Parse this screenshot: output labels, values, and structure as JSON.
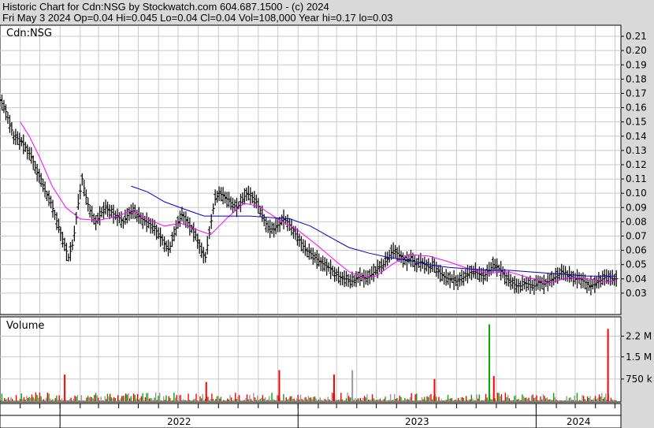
{
  "header": {
    "line1": "Historic Chart for Cdn:NSG by Stockwatch.com 604.687.1500 - (c) 2024",
    "line2": "Fri May  3 2024   Op=0.04   Hi=0.045   Lo=0.04   Cl=0.04   Vol=108,000   Year hi=0.17   lo=0.03"
  },
  "chart_data": [
    {
      "type": "line",
      "subtype": "ohlc",
      "title": "Cdn:NSG",
      "ylim": [
        0.02,
        0.215
      ],
      "y_ticks": [
        "0.21",
        "0.20",
        "0.19",
        "0.18",
        "0.17",
        "0.16",
        "0.15",
        "0.14",
        "0.13",
        "0.12",
        "0.11",
        "0.10",
        "0.09",
        "0.08",
        "0.07",
        "0.06",
        "0.05",
        "0.04",
        "0.03"
      ],
      "y_tick_values": [
        0.21,
        0.2,
        0.19,
        0.18,
        0.17,
        0.16,
        0.15,
        0.14,
        0.13,
        0.12,
        0.11,
        0.1,
        0.09,
        0.08,
        0.07,
        0.06,
        0.05,
        0.04,
        0.03
      ],
      "x_labels": [
        "2022",
        "2023",
        "2024"
      ],
      "x_range": [
        "2021-10",
        "2024-05"
      ],
      "grid": true,
      "price_path": [
        [
          "2021-10-01",
          0.165
        ],
        [
          "2021-10-08",
          0.16
        ],
        [
          "2021-10-15",
          0.15
        ],
        [
          "2021-10-22",
          0.14
        ],
        [
          "2021-10-29",
          0.138
        ],
        [
          "2021-11-05",
          0.135
        ],
        [
          "2021-11-12",
          0.13
        ],
        [
          "2021-11-19",
          0.125
        ],
        [
          "2021-11-26",
          0.115
        ],
        [
          "2021-12-03",
          0.11
        ],
        [
          "2021-12-10",
          0.1
        ],
        [
          "2021-12-17",
          0.095
        ],
        [
          "2021-12-24",
          0.085
        ],
        [
          "2021-12-31",
          0.075
        ],
        [
          "2022-01-07",
          0.065
        ],
        [
          "2022-01-14",
          0.055
        ],
        [
          "2022-01-21",
          0.065
        ],
        [
          "2022-01-28",
          0.09
        ],
        [
          "2022-02-04",
          0.11
        ],
        [
          "2022-02-11",
          0.095
        ],
        [
          "2022-02-18",
          0.085
        ],
        [
          "2022-02-25",
          0.08
        ],
        [
          "2022-03-04",
          0.085
        ],
        [
          "2022-03-11",
          0.09
        ],
        [
          "2022-03-18",
          0.088
        ],
        [
          "2022-03-25",
          0.085
        ],
        [
          "2022-04-01",
          0.083
        ],
        [
          "2022-04-08",
          0.08
        ],
        [
          "2022-04-15",
          0.085
        ],
        [
          "2022-04-22",
          0.088
        ],
        [
          "2022-04-29",
          0.085
        ],
        [
          "2022-05-06",
          0.082
        ],
        [
          "2022-05-13",
          0.08
        ],
        [
          "2022-05-20",
          0.078
        ],
        [
          "2022-05-27",
          0.075
        ],
        [
          "2022-06-03",
          0.07
        ],
        [
          "2022-06-10",
          0.065
        ],
        [
          "2022-06-17",
          0.06
        ],
        [
          "2022-06-24",
          0.07
        ],
        [
          "2022-07-01",
          0.08
        ],
        [
          "2022-07-08",
          0.085
        ],
        [
          "2022-07-15",
          0.08
        ],
        [
          "2022-07-22",
          0.075
        ],
        [
          "2022-07-29",
          0.07
        ],
        [
          "2022-08-05",
          0.06
        ],
        [
          "2022-08-12",
          0.055
        ],
        [
          "2022-08-19",
          0.075
        ],
        [
          "2022-08-26",
          0.095
        ],
        [
          "2022-09-02",
          0.1
        ],
        [
          "2022-09-09",
          0.098
        ],
        [
          "2022-09-16",
          0.095
        ],
        [
          "2022-09-23",
          0.092
        ],
        [
          "2022-09-30",
          0.09
        ],
        [
          "2022-10-07",
          0.095
        ],
        [
          "2022-10-14",
          0.1
        ],
        [
          "2022-10-21",
          0.098
        ],
        [
          "2022-10-28",
          0.095
        ],
        [
          "2022-11-04",
          0.088
        ],
        [
          "2022-11-11",
          0.08
        ],
        [
          "2022-11-18",
          0.075
        ],
        [
          "2022-11-25",
          0.075
        ],
        [
          "2022-12-02",
          0.078
        ],
        [
          "2022-12-09",
          0.082
        ],
        [
          "2022-12-16",
          0.08
        ],
        [
          "2022-12-23",
          0.075
        ],
        [
          "2022-12-30",
          0.07
        ],
        [
          "2023-01-06",
          0.065
        ],
        [
          "2023-01-13",
          0.06
        ],
        [
          "2023-01-20",
          0.058
        ],
        [
          "2023-01-27",
          0.055
        ],
        [
          "2023-02-03",
          0.052
        ],
        [
          "2023-02-10",
          0.05
        ],
        [
          "2023-02-17",
          0.048
        ],
        [
          "2023-02-24",
          0.045
        ],
        [
          "2023-03-03",
          0.042
        ],
        [
          "2023-03-10",
          0.04
        ],
        [
          "2023-03-17",
          0.04
        ],
        [
          "2023-03-24",
          0.038
        ],
        [
          "2023-03-31",
          0.04
        ],
        [
          "2023-04-07",
          0.042
        ],
        [
          "2023-04-14",
          0.04
        ],
        [
          "2023-04-21",
          0.042
        ],
        [
          "2023-04-28",
          0.045
        ],
        [
          "2023-05-05",
          0.048
        ],
        [
          "2023-05-12",
          0.05
        ],
        [
          "2023-05-19",
          0.055
        ],
        [
          "2023-05-26",
          0.06
        ],
        [
          "2023-06-02",
          0.058
        ],
        [
          "2023-06-09",
          0.055
        ],
        [
          "2023-06-16",
          0.052
        ],
        [
          "2023-06-23",
          0.055
        ],
        [
          "2023-06-30",
          0.05
        ],
        [
          "2023-07-07",
          0.052
        ],
        [
          "2023-07-14",
          0.05
        ],
        [
          "2023-07-21",
          0.048
        ],
        [
          "2023-07-28",
          0.05
        ],
        [
          "2023-08-04",
          0.045
        ],
        [
          "2023-08-11",
          0.042
        ],
        [
          "2023-08-18",
          0.04
        ],
        [
          "2023-08-25",
          0.04
        ],
        [
          "2023-09-01",
          0.038
        ],
        [
          "2023-09-08",
          0.04
        ],
        [
          "2023-09-15",
          0.042
        ],
        [
          "2023-09-22",
          0.045
        ],
        [
          "2023-09-29",
          0.045
        ],
        [
          "2023-10-06",
          0.043
        ],
        [
          "2023-10-13",
          0.042
        ],
        [
          "2023-10-20",
          0.045
        ],
        [
          "2023-10-27",
          0.05
        ],
        [
          "2023-11-03",
          0.048
        ],
        [
          "2023-11-10",
          0.045
        ],
        [
          "2023-11-17",
          0.04
        ],
        [
          "2023-11-24",
          0.038
        ],
        [
          "2023-12-01",
          0.035
        ],
        [
          "2023-12-08",
          0.035
        ],
        [
          "2023-12-15",
          0.037
        ],
        [
          "2023-12-22",
          0.036
        ],
        [
          "2023-12-29",
          0.035
        ],
        [
          "2024-01-05",
          0.038
        ],
        [
          "2024-01-12",
          0.036
        ],
        [
          "2024-01-19",
          0.038
        ],
        [
          "2024-01-26",
          0.04
        ],
        [
          "2024-02-02",
          0.042
        ],
        [
          "2024-02-09",
          0.045
        ],
        [
          "2024-02-16",
          0.043
        ],
        [
          "2024-02-23",
          0.042
        ],
        [
          "2024-03-01",
          0.04
        ],
        [
          "2024-03-08",
          0.04
        ],
        [
          "2024-03-15",
          0.038
        ],
        [
          "2024-03-22",
          0.035
        ],
        [
          "2024-03-29",
          0.036
        ],
        [
          "2024-04-05",
          0.038
        ],
        [
          "2024-04-12",
          0.04
        ],
        [
          "2024-04-19",
          0.042
        ],
        [
          "2024-04-26",
          0.04
        ],
        [
          "2024-05-03",
          0.04
        ]
      ],
      "series": [
        {
          "name": "short moving average",
          "color": "#ff00ff",
          "points": [
            [
              "2021-11-01",
              0.15
            ],
            [
              "2021-11-15",
              0.14
            ],
            [
              "2021-12-01",
              0.125
            ],
            [
              "2021-12-20",
              0.105
            ],
            [
              "2022-01-10",
              0.09
            ],
            [
              "2022-02-01",
              0.082
            ],
            [
              "2022-03-01",
              0.081
            ],
            [
              "2022-04-01",
              0.084
            ],
            [
              "2022-04-20",
              0.088
            ],
            [
              "2022-05-15",
              0.082
            ],
            [
              "2022-06-10",
              0.077
            ],
            [
              "2022-07-05",
              0.079
            ],
            [
              "2022-08-01",
              0.074
            ],
            [
              "2022-08-20",
              0.071
            ],
            [
              "2022-09-15",
              0.083
            ],
            [
              "2022-10-10",
              0.093
            ],
            [
              "2022-11-01",
              0.091
            ],
            [
              "2022-12-01",
              0.082
            ],
            [
              "2023-01-01",
              0.074
            ],
            [
              "2023-02-01",
              0.063
            ],
            [
              "2023-03-01",
              0.052
            ],
            [
              "2023-03-20",
              0.045
            ],
            [
              "2023-04-10",
              0.041
            ],
            [
              "2023-05-01",
              0.042
            ],
            [
              "2023-05-25",
              0.05
            ],
            [
              "2023-06-20",
              0.057
            ],
            [
              "2023-07-20",
              0.056
            ],
            [
              "2023-08-20",
              0.052
            ],
            [
              "2023-09-20",
              0.047
            ],
            [
              "2023-10-20",
              0.044
            ],
            [
              "2023-11-20",
              0.045
            ],
            [
              "2023-12-20",
              0.041
            ],
            [
              "2024-01-20",
              0.037
            ],
            [
              "2024-02-20",
              0.041
            ],
            [
              "2024-03-20",
              0.04
            ],
            [
              "2024-04-20",
              0.038
            ],
            [
              "2024-05-03",
              0.039
            ]
          ]
        },
        {
          "name": "long moving average",
          "color": "#0000cc",
          "points": [
            [
              "2022-04-20",
              0.105
            ],
            [
              "2022-05-15",
              0.101
            ],
            [
              "2022-06-10",
              0.094
            ],
            [
              "2022-07-10",
              0.089
            ],
            [
              "2022-08-10",
              0.084
            ],
            [
              "2022-09-15",
              0.084
            ],
            [
              "2022-10-20",
              0.084
            ],
            [
              "2022-11-20",
              0.083
            ],
            [
              "2022-12-20",
              0.082
            ],
            [
              "2023-01-20",
              0.077
            ],
            [
              "2023-02-20",
              0.069
            ],
            [
              "2023-03-20",
              0.062
            ],
            [
              "2023-04-20",
              0.058
            ],
            [
              "2023-05-20",
              0.055
            ],
            [
              "2023-06-20",
              0.053
            ],
            [
              "2023-07-20",
              0.05
            ],
            [
              "2023-08-20",
              0.048
            ],
            [
              "2023-09-20",
              0.047
            ],
            [
              "2023-10-20",
              0.046
            ],
            [
              "2023-11-20",
              0.046
            ],
            [
              "2023-12-20",
              0.045
            ],
            [
              "2024-01-20",
              0.044
            ],
            [
              "2024-02-20",
              0.043
            ],
            [
              "2024-03-20",
              0.042
            ],
            [
              "2024-04-20",
              0.042
            ],
            [
              "2024-05-03",
              0.042
            ]
          ]
        }
      ]
    },
    {
      "type": "bar",
      "title": "Volume",
      "ylim": [
        0,
        2800000
      ],
      "y_ticks": [
        "2.2 M",
        "1.5 M",
        "750 k"
      ],
      "y_tick_values": [
        2200000,
        1500000,
        750000
      ],
      "colors": {
        "up": "#00aa00",
        "down": "#ff0000",
        "unchanged": "#999999"
      },
      "notable_bars": [
        {
          "date": "2023-10-20",
          "value": 2600000,
          "direction": "up"
        },
        {
          "date": "2024-04-19",
          "value": 2450000,
          "direction": "down"
        },
        {
          "date": "2022-01-07",
          "value": 900000,
          "direction": "down"
        },
        {
          "date": "2022-08-12",
          "value": 650000,
          "direction": "down"
        },
        {
          "date": "2022-12-02",
          "value": 1050000,
          "direction": "down"
        },
        {
          "date": "2023-02-24",
          "value": 900000,
          "direction": "down"
        },
        {
          "date": "2023-03-24",
          "value": 1050000,
          "direction": "unchanged"
        },
        {
          "date": "2023-07-28",
          "value": 750000,
          "direction": "down"
        },
        {
          "date": "2023-10-27",
          "value": 850000,
          "direction": "down"
        }
      ]
    }
  ]
}
